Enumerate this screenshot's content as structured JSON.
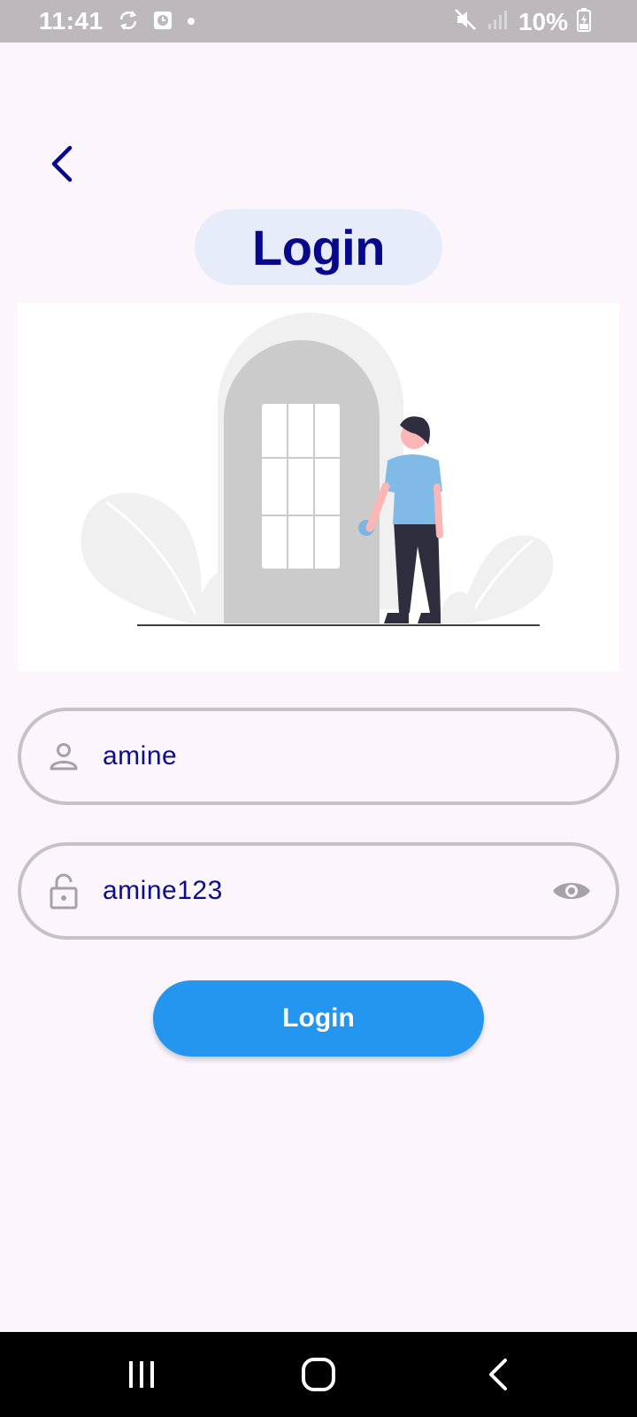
{
  "status_bar": {
    "time": "11:41",
    "battery": "10%",
    "left_icons": [
      "sync-icon",
      "alarm-icon",
      "dot-icon"
    ],
    "right_icons": [
      "mute-icon",
      "signal-icon",
      "battery-charging-icon"
    ]
  },
  "header": {
    "back_icon": "chevron-left-icon",
    "title": "Login"
  },
  "form": {
    "username": {
      "value": "amine",
      "icon": "person-icon"
    },
    "password": {
      "value": "amine123",
      "icon": "lock-icon",
      "toggle_icon": "eye-icon"
    },
    "submit_label": "Login"
  },
  "colors": {
    "accent": "#2596f0",
    "title": "#07088c",
    "title_bg": "#e6ecfa",
    "input_text": "#0b0e8a",
    "background": "#fcf6fc"
  },
  "nav_bar": {
    "icons": [
      "recents-icon",
      "home-icon",
      "back-icon"
    ]
  }
}
